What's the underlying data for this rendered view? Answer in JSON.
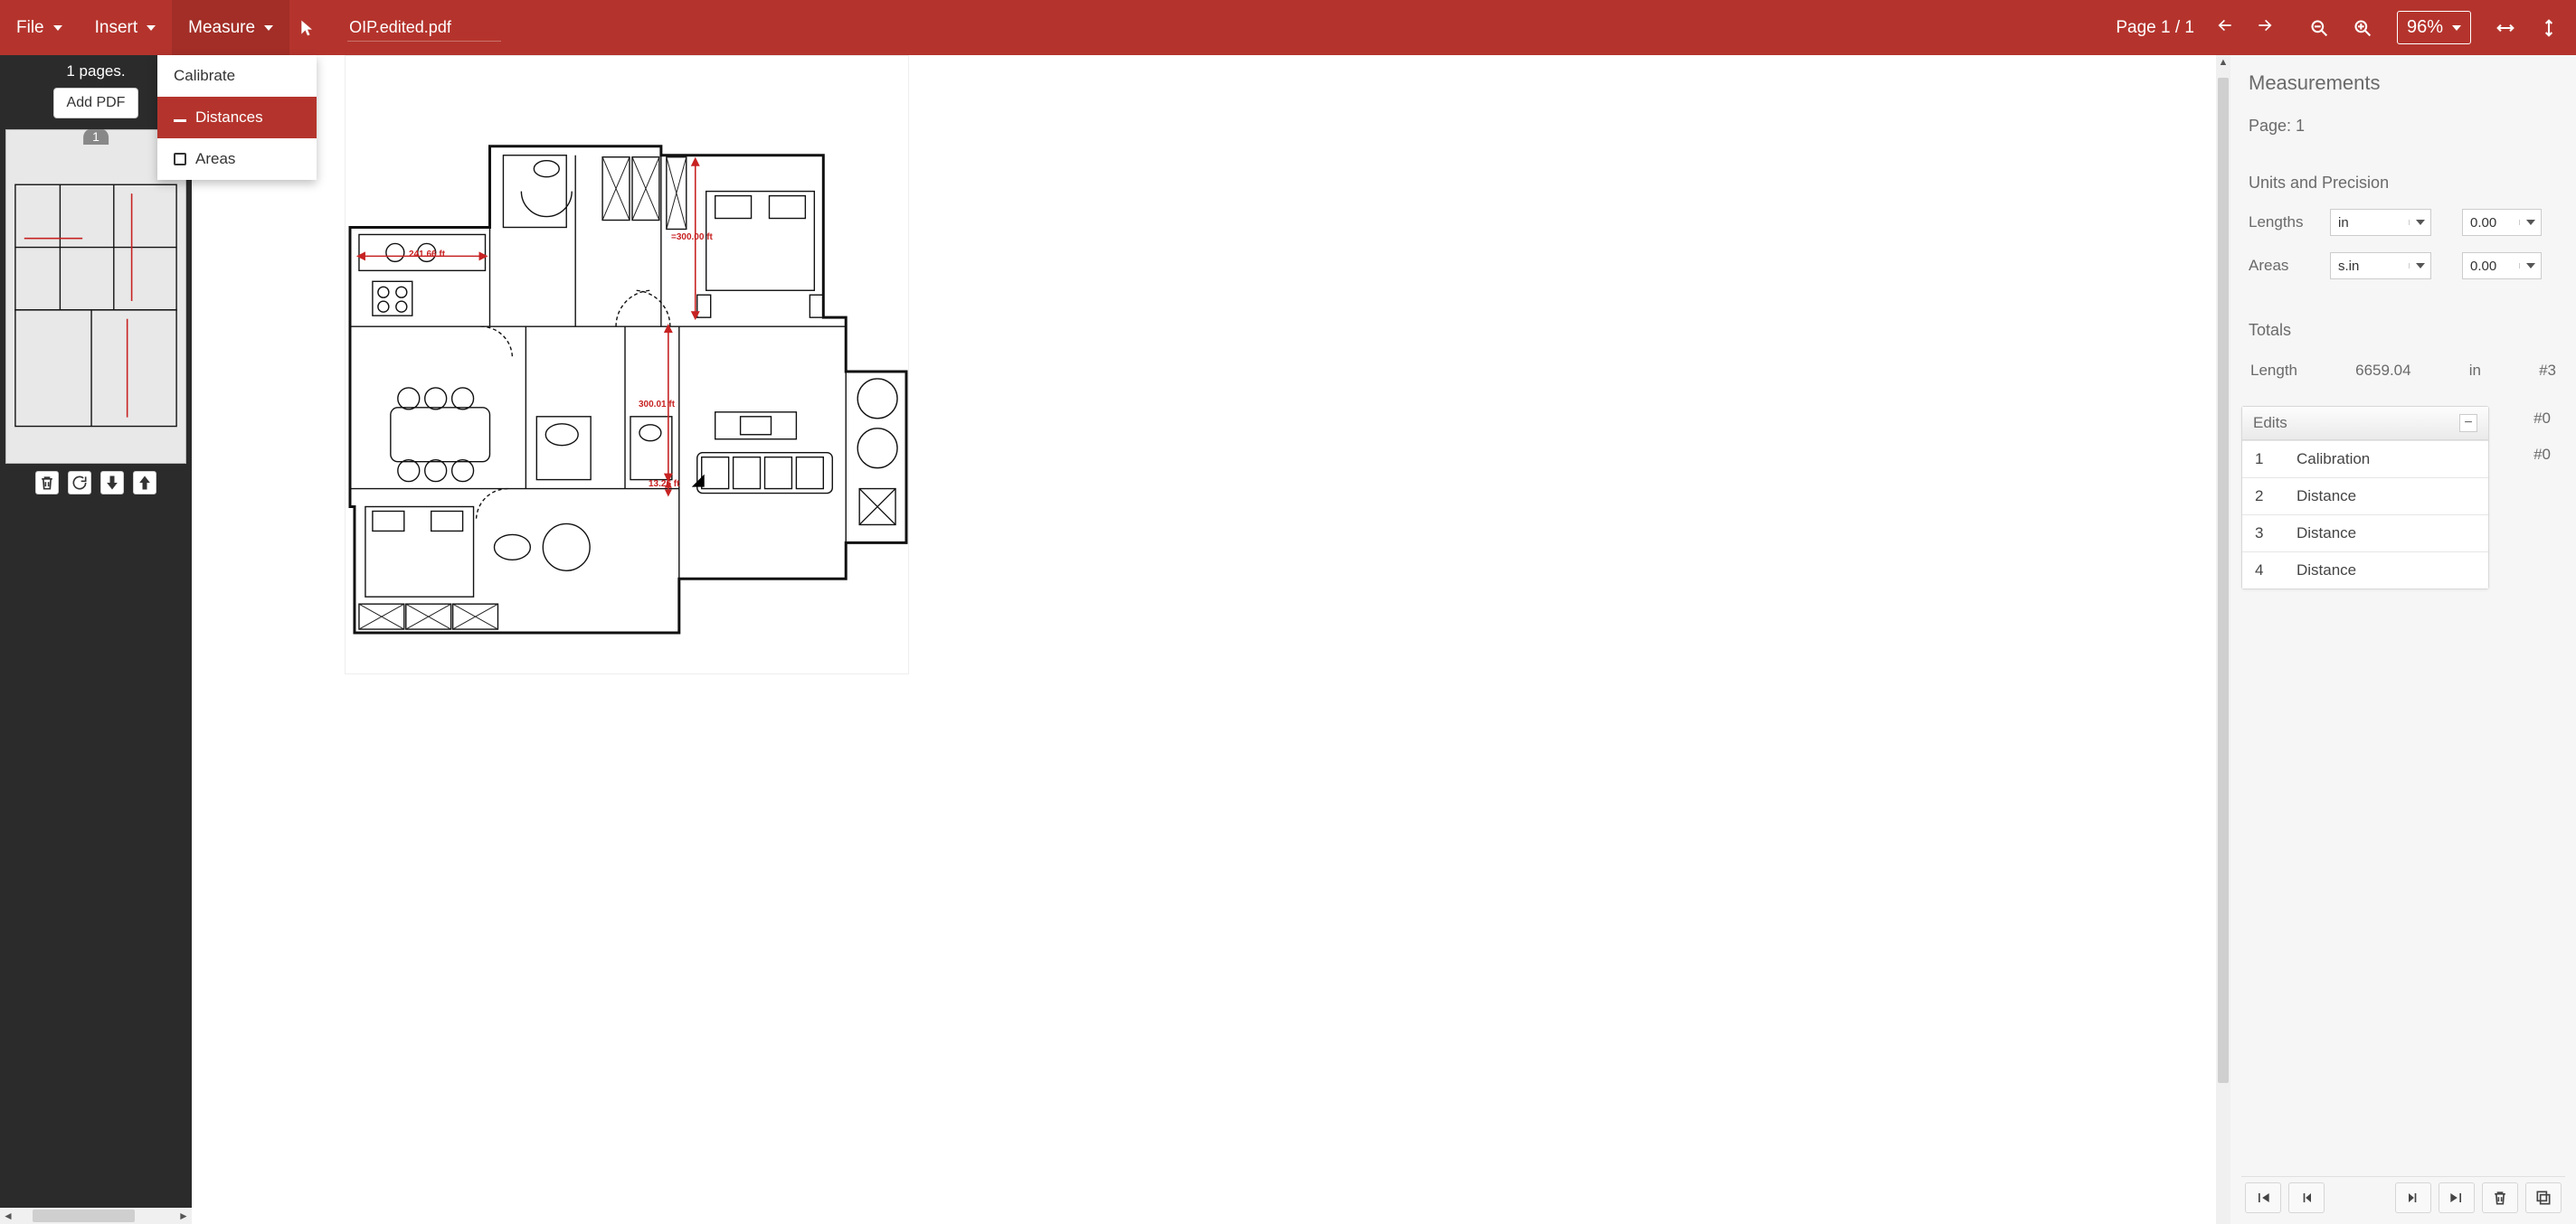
{
  "menus": {
    "file": "File",
    "insert": "Insert",
    "measure": "Measure",
    "dropdown": {
      "calibrate": "Calibrate",
      "distances": "Distances",
      "areas": "Areas"
    }
  },
  "filename": "OIP.edited.pdf",
  "page_nav": {
    "label": "Page 1 / 1"
  },
  "zoom": {
    "label": "96%"
  },
  "left": {
    "pages_label": "1 pages.",
    "add_pdf": "Add PDF",
    "thumb_badge": "1"
  },
  "annotations": {
    "dim1": "241.66 ft",
    "dim2": "=300.00 ft",
    "dim3": "300.01 ft",
    "dim4": "13.26 ft"
  },
  "right": {
    "title": "Measurements",
    "page_label": "Page: 1",
    "units_title": "Units and Precision",
    "lengths_label": "Lengths",
    "lengths_unit": "in",
    "lengths_precision": "0.00",
    "areas_label": "Areas",
    "areas_unit": "s.in",
    "areas_precision": "0.00",
    "totals_title": "Totals",
    "totals_length_label": "Length",
    "totals_length_value": "6659.04",
    "totals_length_unit": "in",
    "totals_length_count": "#3",
    "count_b": "#0",
    "count_c": "#0",
    "edits_title": "Edits",
    "edits": [
      {
        "n": "1",
        "label": "Calibration"
      },
      {
        "n": "2",
        "label": "Distance"
      },
      {
        "n": "3",
        "label": "Distance"
      },
      {
        "n": "4",
        "label": "Distance"
      }
    ]
  }
}
